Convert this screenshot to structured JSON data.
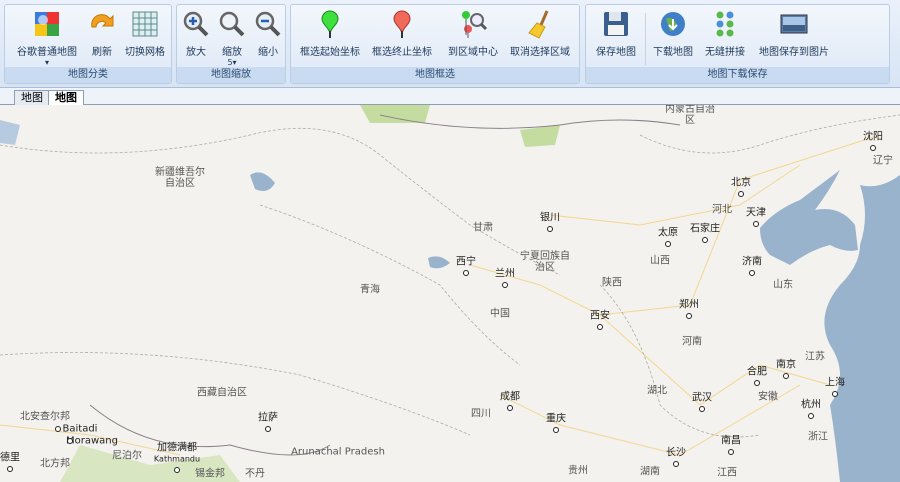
{
  "ribbon": {
    "groups": [
      {
        "label": "地图分类",
        "buttons": [
          {
            "label": "谷歌普通地图",
            "icon": "google-maps-icon",
            "dropdown": "▾"
          },
          {
            "label": "刷新",
            "icon": "refresh-icon"
          },
          {
            "label": "切换网格",
            "icon": "grid-icon"
          }
        ]
      },
      {
        "label": "地图缩放",
        "buttons": [
          {
            "label": "放大",
            "icon": "zoom-in-icon"
          },
          {
            "label": "缩放",
            "icon": "zoom-icon",
            "dropdown": "5▾"
          },
          {
            "label": "缩小",
            "icon": "zoom-out-icon"
          }
        ]
      },
      {
        "label": "地图框选",
        "buttons": [
          {
            "label": "框选起始坐标",
            "icon": "green-pin-icon"
          },
          {
            "label": "框选终止坐标",
            "icon": "red-pin-icon"
          },
          {
            "label": "到区域中心",
            "icon": "area-center-icon"
          },
          {
            "label": "取消选择区域",
            "icon": "broom-icon"
          }
        ]
      },
      {
        "label": "地图下载保存",
        "buttons": [
          {
            "label": "保存地图",
            "icon": "floppy-disk-icon"
          },
          {
            "label": "下载地图",
            "icon": "globe-download-icon"
          },
          {
            "label": "无缝拼接",
            "icon": "stitch-icon"
          },
          {
            "label": "地图保存到图片",
            "icon": "picture-icon"
          }
        ]
      }
    ]
  },
  "tabs": [
    {
      "label": "地图"
    },
    {
      "label": "地图",
      "active": true
    }
  ],
  "colors": {
    "water": "#99b3cc",
    "land": "#f4f2ee",
    "road": "#f3d58f",
    "park": "#c5dca0"
  },
  "map": {
    "regions": [
      "新疆维吾尔自治区",
      "甘肃",
      "宁夏回族自治区",
      "青海",
      "中国",
      "陕西",
      "内蒙古自治区",
      "河北",
      "山西",
      "山东",
      "辽宁",
      "河南",
      "江苏",
      "湖北",
      "安徽",
      "四川",
      "浙江",
      "贵州",
      "湖南",
      "江西",
      "西藏自治区",
      "Arunachal Pradesh",
      "尼泊尔",
      "北安查尔邦",
      "北方邦",
      "锡金邦",
      "不丹"
    ],
    "cities": [
      "银川",
      "西宁",
      "兰州",
      "西安",
      "北京",
      "天津",
      "太原",
      "石家庄",
      "济南",
      "沈阳",
      "郑州",
      "南京",
      "合肥",
      "上海",
      "武汉",
      "杭州",
      "成都",
      "重庆",
      "南昌",
      "长沙",
      "拉萨",
      "加德满都",
      "Kathmandu",
      "德里",
      "Baitadi",
      "Morawang"
    ]
  }
}
